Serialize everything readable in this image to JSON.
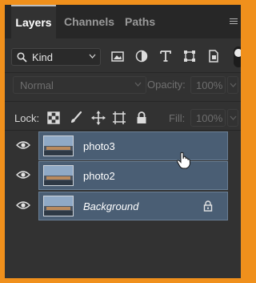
{
  "tabs": [
    {
      "label": "Layers",
      "active": true
    },
    {
      "label": "Channels",
      "active": false
    },
    {
      "label": "Paths",
      "active": false
    }
  ],
  "filter": {
    "kind_label": "Kind",
    "icons": [
      "image-filter-icon",
      "adjustment-filter-icon",
      "type-filter-icon",
      "shape-filter-icon",
      "smart-object-filter-icon"
    ]
  },
  "blend": {
    "mode": "Normal",
    "opacity_label": "Opacity:",
    "opacity_value": "100%"
  },
  "lock": {
    "label": "Lock:",
    "fill_label": "Fill:",
    "fill_value": "100%"
  },
  "layers": [
    {
      "name": "photo3",
      "visible": true,
      "locked": false,
      "italic": false
    },
    {
      "name": "photo2",
      "visible": true,
      "locked": false,
      "italic": false
    },
    {
      "name": "Background",
      "visible": true,
      "locked": true,
      "italic": true
    }
  ],
  "colors": {
    "frame_border": "#f0901c",
    "panel_bg": "#323232",
    "layer_selected": "#4a5e74"
  }
}
